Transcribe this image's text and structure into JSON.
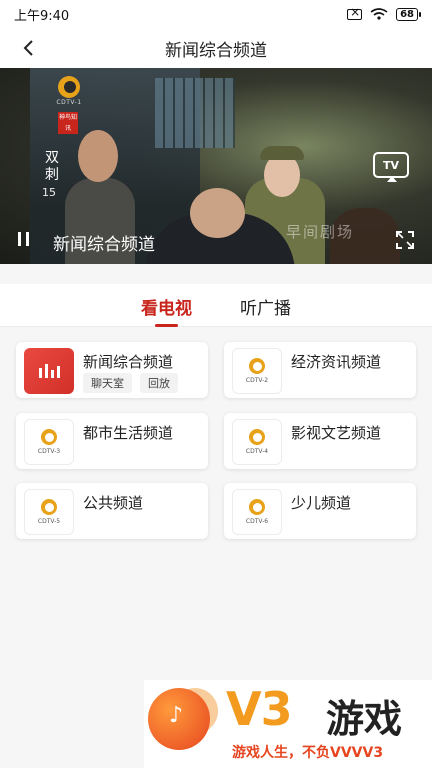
{
  "status_bar": {
    "time": "上午9:40",
    "battery": "68"
  },
  "header": {
    "title": "新闻综合频道"
  },
  "player": {
    "channel_title": "新闻综合频道",
    "logo_text": "CDTV-1",
    "badge_text": "神鸟知讯",
    "show_vertical": "双刺",
    "episode": "15",
    "watermark": "早间剧场",
    "cast_label": "TV"
  },
  "tabs": [
    {
      "label": "看电视",
      "active": true
    },
    {
      "label": "听广播",
      "active": false
    }
  ],
  "channels": [
    {
      "name": "新闻综合频道",
      "logo": "",
      "chips": [
        "聊天室",
        "回放"
      ]
    },
    {
      "name": "经济资讯频道",
      "logo": "CDTV-2",
      "chips": []
    },
    {
      "name": "都市生活频道",
      "logo": "CDTV-3",
      "chips": []
    },
    {
      "name": "影视文艺频道",
      "logo": "CDTV-4",
      "chips": []
    },
    {
      "name": "公共频道",
      "logo": "CDTV-5",
      "chips": []
    },
    {
      "name": "少儿频道",
      "logo": "CDTV-6",
      "chips": []
    }
  ],
  "ad": {
    "brand": "V3",
    "game": "游戏",
    "slogan": "游戏人生，不负VVVV3"
  },
  "colors": {
    "accent": "#c8261d",
    "logo_orange": "#e8a21a"
  }
}
